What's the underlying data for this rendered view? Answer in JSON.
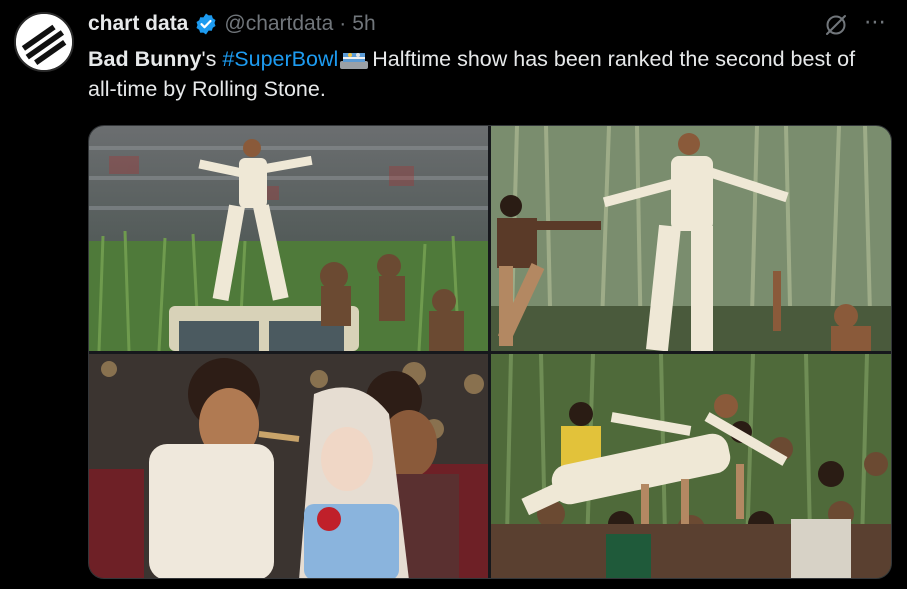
{
  "tweet": {
    "display_name": "chart data",
    "handle": "@chartdata",
    "separator": "·",
    "time": "5h",
    "text_bold": "Bad Bunny",
    "text_after_bold": "'s ",
    "hashtag": "#SuperBowl",
    "text_rest": "Halftime show has been ranked the second best of all-time by Rolling Stone."
  },
  "icons": {
    "avatar": "chart-data-logo",
    "verified": "verified-badge-icon",
    "grok": "grok-icon",
    "more": "more-icon",
    "emoji": "football-field-emoji"
  },
  "colors": {
    "link": "#1d9bf0",
    "verified": "#1d9bf0",
    "muted": "#71767b",
    "text": "#e7e9ea"
  },
  "more_glyph": "⋯",
  "media_count": 4
}
